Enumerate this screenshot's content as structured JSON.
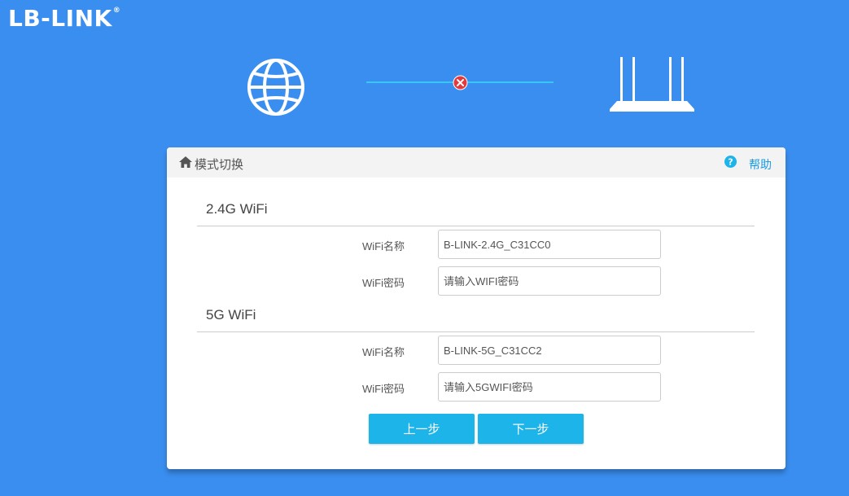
{
  "brand": {
    "logo_text": "LB-LINK",
    "registered_mark": "®"
  },
  "status": {
    "internet_icon": "globe-icon",
    "connection_state_icon": "disconnected-x-icon",
    "router_icon": "router-icon",
    "colors": {
      "background": "#3a8ef0",
      "line": "#38c6f4",
      "error": "#e5393b"
    }
  },
  "panel": {
    "title": "模式切换",
    "help_label": "帮助",
    "sections": [
      {
        "title": "2.4G WiFi",
        "fields": [
          {
            "label": "WiFi名称",
            "value": "B-LINK-2.4G_C31CC0",
            "placeholder": ""
          },
          {
            "label": "WiFi密码",
            "value": "",
            "placeholder": "请输入WIFI密码"
          }
        ]
      },
      {
        "title": "5G WiFi",
        "fields": [
          {
            "label": "WiFi名称",
            "value": "B-LINK-5G_C31CC2",
            "placeholder": ""
          },
          {
            "label": "WiFi密码",
            "value": "",
            "placeholder": "请输入5GWIFI密码"
          }
        ]
      }
    ],
    "buttons": {
      "prev_label": "上一步",
      "next_label": "下一步",
      "color": "#1db4ea"
    }
  }
}
